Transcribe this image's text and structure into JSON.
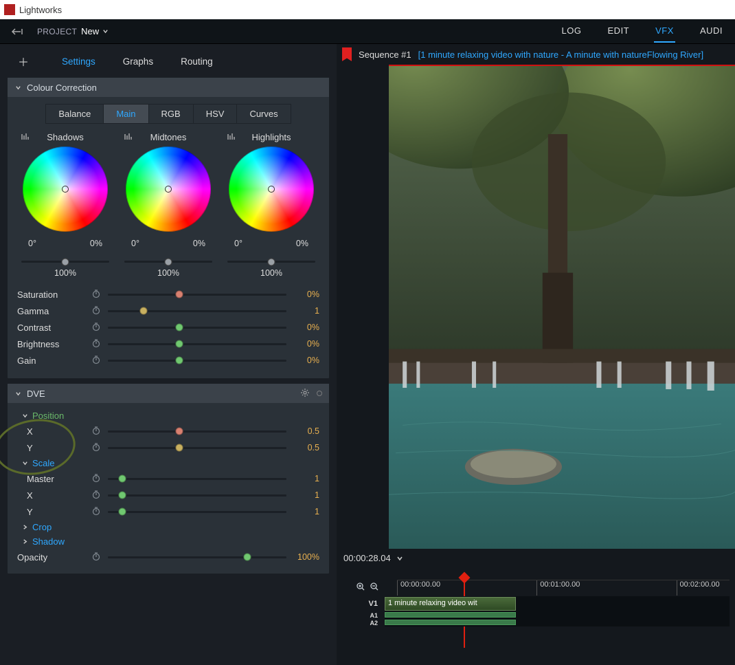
{
  "app": {
    "name": "Lightworks"
  },
  "projectbar": {
    "label": "PROJECT",
    "name": "New"
  },
  "main_tabs": {
    "log": "LOG",
    "edit": "EDIT",
    "vfx": "VFX",
    "audio": "AUDI",
    "active": "VFX"
  },
  "left_tabs": {
    "settings": "Settings",
    "graphs": "Graphs",
    "routing": "Routing",
    "active": "Settings"
  },
  "cc": {
    "title": "Colour Correction",
    "tabs": {
      "balance": "Balance",
      "main": "Main",
      "rgb": "RGB",
      "hsv": "HSV",
      "curves": "Curves",
      "active": "Main"
    },
    "wheels": {
      "shadows": {
        "label": "Shadows",
        "deg": "0°",
        "pct": "0%",
        "slider_pct": "100%"
      },
      "midtones": {
        "label": "Midtones",
        "deg": "0°",
        "pct": "0%",
        "slider_pct": "100%"
      },
      "highlights": {
        "label": "Highlights",
        "deg": "0°",
        "pct": "0%",
        "slider_pct": "100%"
      }
    },
    "params": {
      "saturation": {
        "label": "Saturation",
        "value": "0%"
      },
      "gamma": {
        "label": "Gamma",
        "value": "1"
      },
      "contrast": {
        "label": "Contrast",
        "value": "0%"
      },
      "brightness": {
        "label": "Brightness",
        "value": "0%"
      },
      "gain": {
        "label": "Gain",
        "value": "0%"
      }
    }
  },
  "dve": {
    "title": "DVE",
    "position": {
      "label": "Position",
      "x_label": "X",
      "x_value": "0.5",
      "y_label": "Y",
      "y_value": "0.5"
    },
    "scale": {
      "label": "Scale",
      "master_label": "Master",
      "master_value": "1",
      "x_label": "X",
      "x_value": "1",
      "y_label": "Y",
      "y_value": "1"
    },
    "crop": {
      "label": "Crop"
    },
    "shadow": {
      "label": "Shadow"
    },
    "opacity": {
      "label": "Opacity",
      "value": "100%"
    }
  },
  "sequence": {
    "name": "Sequence #1",
    "subtitle": "[1 minute relaxing video with nature - A minute with natureFlowing River]",
    "timecode": "00:00:28.04"
  },
  "timeline": {
    "ticks": {
      "t0": "00:00:00.00",
      "t1": "00:01:00.00",
      "t2": "00:02:00.00"
    },
    "v1": "V1",
    "a1": "A1",
    "a2": "A2",
    "clip_label": "1 minute relaxing video wit"
  }
}
